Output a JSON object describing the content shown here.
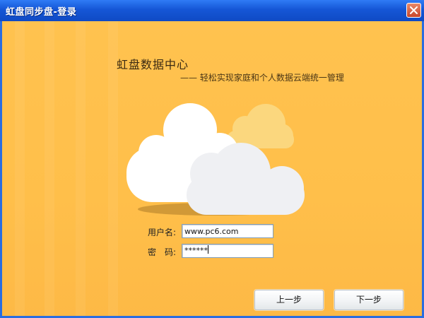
{
  "window": {
    "title": "虹盘同步盘-登录"
  },
  "header": {
    "headline": "虹盘数据中心",
    "subline": "—— 轻松实现家庭和个人数据云端统一管理"
  },
  "form": {
    "username_label": "用户名:",
    "username_value": "www.pc6.com",
    "password_label": "密　码:",
    "password_value": "******"
  },
  "buttons": {
    "prev_label": "上一步",
    "next_label": "下一步"
  },
  "icons": {
    "close": "close-icon",
    "illustration": "cloud-illustration"
  },
  "colors": {
    "titlebar": "#1556d6",
    "background": "#ffc24f",
    "close_button": "#c8462a"
  }
}
